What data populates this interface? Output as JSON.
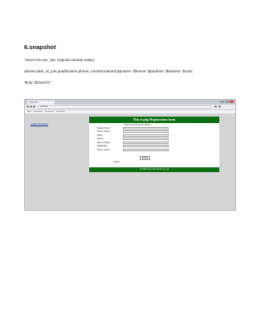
{
  "document": {
    "heading": "6.snapshot",
    "code_lines": [
      "\"insert into  per_doc (regular,number,salary,",
      "adress,date_of_join,qualification,phone_number)values('$pname','$fname','$padress','$tadress','$mob',",
      " '$city','$idcard')\";"
    ]
  },
  "screenshot": {
    "tab_title": "a php form",
    "url": "localhost/",
    "bookmarks": [
      "Apps",
      "Bookmarks",
      "Downloads",
      "Yahoo Mail"
    ],
    "side_link": "Logout from Admin",
    "form": {
      "header": "This is php Registration form",
      "title": "Insert into Permanent Doctor",
      "fields": [
        "Regular Doctor",
        "Doctor Number",
        "Salary",
        "Adress",
        "Date of Joining",
        "qualification",
        "phone_number"
      ],
      "submit_label": "Submit",
      "upload_label": "Upload",
      "footer": "(c) 2014 copy write of php my_sql"
    }
  }
}
